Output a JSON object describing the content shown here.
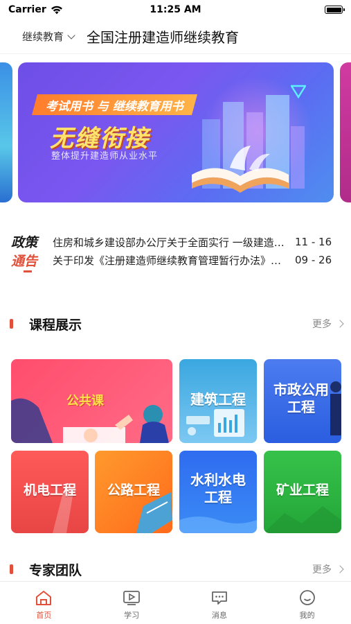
{
  "status_bar": {
    "carrier": "Carrier",
    "time": "11:25 AM"
  },
  "header": {
    "category": "继续教育",
    "title": "全国注册建造师继续教育"
  },
  "banner": {
    "tagline": "考试用书 与 继续教育用书",
    "headline": "无缝衔接",
    "subtitle": "整体提升建造师从业水平"
  },
  "policy": {
    "logo_line1": "政策",
    "logo_line2": "通告",
    "items": [
      {
        "text": "住房和城乡建设部办公厅关于全面实行 一级建造师电子注册证书的通知",
        "date": "11 - 16"
      },
      {
        "text": "关于印发《注册建造师继续教育管理暂行办法》的通知",
        "date": "09 - 26"
      }
    ]
  },
  "courses_section": {
    "title": "课程展示",
    "more": "更多"
  },
  "courses": {
    "public": "公共课",
    "arch_line1": "建筑工程",
    "muni_line1": "市政公用",
    "muni_line2": "工程",
    "mech": "机电工程",
    "road": "公路工程",
    "water_line1": "水利水电",
    "water_line2": "工程",
    "mine": "矿业工程"
  },
  "experts_section": {
    "title": "专家团队",
    "more": "更多"
  },
  "tabs": [
    {
      "label": "首页",
      "active": true
    },
    {
      "label": "学习",
      "active": false
    },
    {
      "label": "消息",
      "active": false
    },
    {
      "label": "我的",
      "active": false
    }
  ],
  "colors": {
    "accent": "#e0503a",
    "inactive": "#666666"
  }
}
